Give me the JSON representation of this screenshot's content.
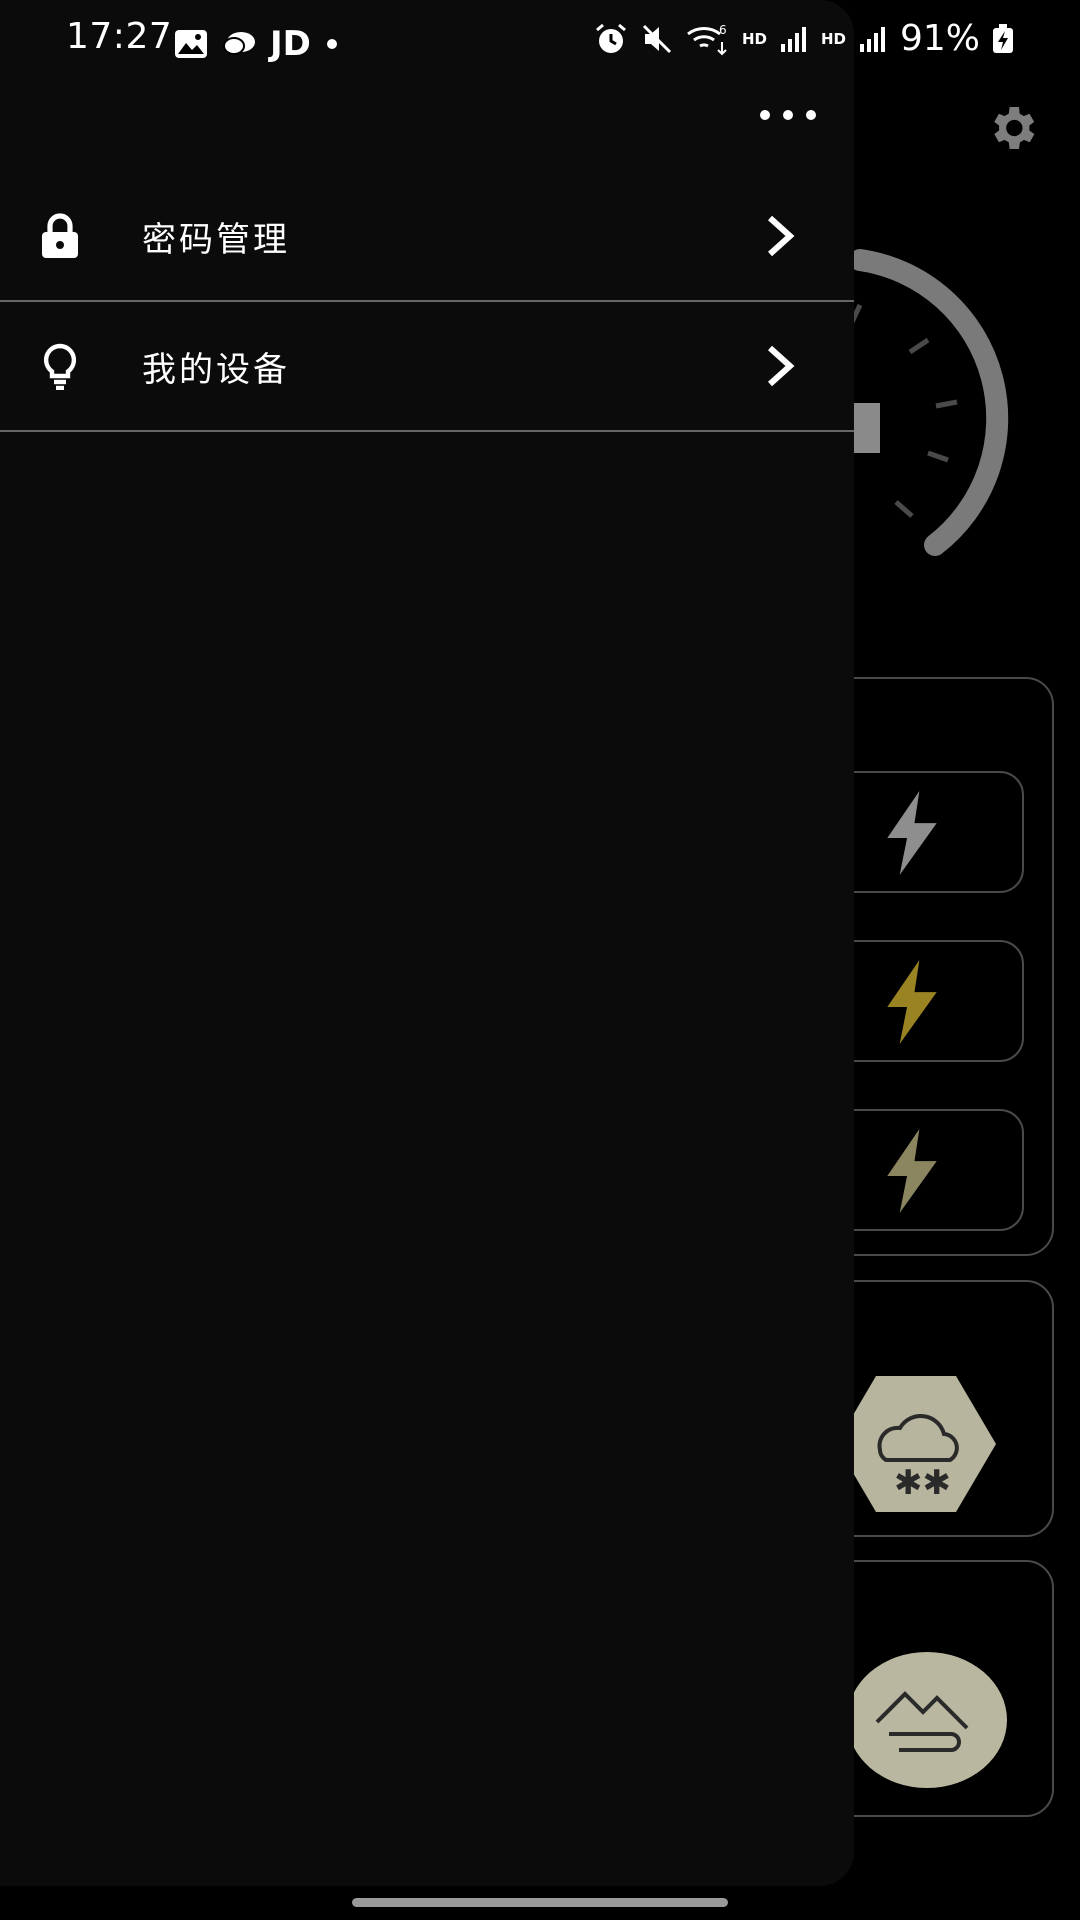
{
  "status_bar": {
    "time": "17:27",
    "carrier_label": "JD",
    "hd_label_1": "HD",
    "hd_label_2": "HD",
    "battery": "91%",
    "icons": [
      "gallery-icon",
      "chat-icon",
      "dot-icon",
      "alarm-icon",
      "mute-icon",
      "wifi-6-icon",
      "signal-icon",
      "signal-icon",
      "battery-charging-icon"
    ]
  },
  "drawer": {
    "menu_items": [
      {
        "label": "密码管理",
        "icon": "lock-icon"
      },
      {
        "label": "我的设备",
        "icon": "lightbulb-icon"
      }
    ]
  },
  "background_page": {
    "settings_icon": "gear-icon",
    "mode_buttons": [
      {
        "icon": "lightning-icon",
        "color": "#8e8e8e"
      },
      {
        "icon": "lightning-icon",
        "color": "#9a8322"
      },
      {
        "icon": "lightning-icon",
        "color": "#8b8660"
      }
    ],
    "weather_icon": "snow-cloud-icon",
    "scene_icon": "mountain-icon"
  },
  "colors": {
    "drawer_bg": "#0b0b0b",
    "divider": "#666666",
    "card_border": "#4a4a4a",
    "gauge_arc": "#7a7a7a"
  }
}
